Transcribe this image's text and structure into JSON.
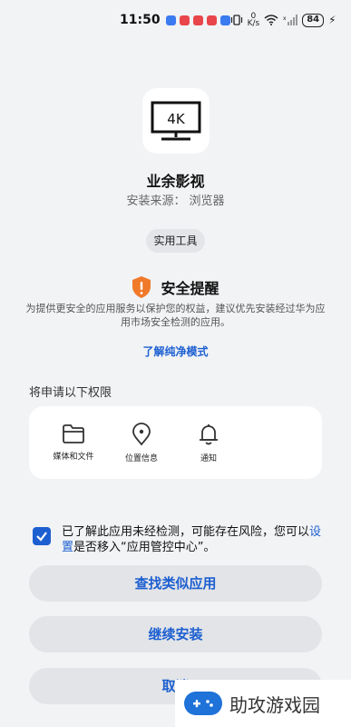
{
  "status_bar": {
    "time": "11:50",
    "network_speed": "0",
    "network_speed_unit": "K/s",
    "battery": "84",
    "notification_colors": [
      "#3b7bf0",
      "#e8464b",
      "#e8464b",
      "#e8464b",
      "#3b7bf0"
    ]
  },
  "app": {
    "name": "业余影视",
    "source_label": "安装来源：",
    "source_value": "浏览器",
    "category": "实用工具",
    "icon_text": "4K"
  },
  "security": {
    "title": "安全提醒",
    "description": "为提供更安全的应用服务以保护您的权益，建议优先安装经过华为应用市场安全检测的应用。",
    "link": "了解纯净模式",
    "shield_color": "#f07a2a"
  },
  "permissions": {
    "heading": "将申请以下权限",
    "items": [
      {
        "label": "媒体和文件",
        "icon": "folder-icon"
      },
      {
        "label": "位置信息",
        "icon": "location-pin-icon"
      },
      {
        "label": "通知",
        "icon": "bell-icon"
      }
    ]
  },
  "consent": {
    "checked": true,
    "text_before": "已了解此应用未经检测，可能存在风险，您可以",
    "link": "设置",
    "text_after": "是否移入“应用管控中心”。"
  },
  "buttons": {
    "find_similar": "查找类似应用",
    "continue_install": "继续安装",
    "cancel": "取消"
  },
  "watermark": {
    "text": "助攻游戏园"
  },
  "colors": {
    "accent": "#1d5fd1",
    "background": "#f1f3f5",
    "button_bg": "#e2e4e7"
  }
}
